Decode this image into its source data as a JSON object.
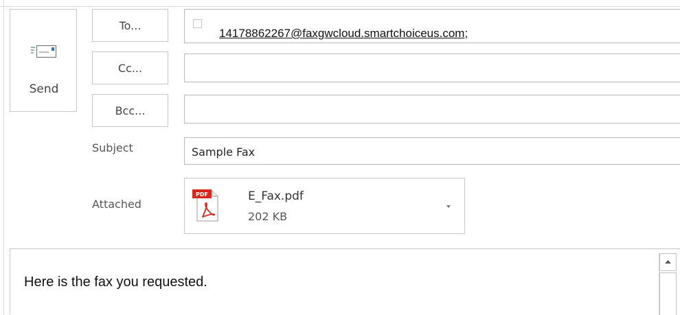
{
  "send": {
    "label": "Send",
    "icon": "send-envelope-icon"
  },
  "address_buttons": {
    "to": "To...",
    "cc": "Cc...",
    "bcc": "Bcc..."
  },
  "fields": {
    "to_value": "14178862267@faxgwcloud.smartchoiceus.com;",
    "cc_value": "",
    "bcc_value": "",
    "subject_label": "Subject",
    "subject_value": "Sample Fax"
  },
  "attachment": {
    "label": "Attached",
    "icon": "pdf-file-icon",
    "icon_badge": "PDF",
    "file_name": "E_Fax.pdf",
    "file_size": "202 KB"
  },
  "message": {
    "body": "Here is the fax you requested."
  },
  "colors": {
    "pdf_red": "#d9261c",
    "border": "#c6c6c6",
    "text": "#444444"
  }
}
